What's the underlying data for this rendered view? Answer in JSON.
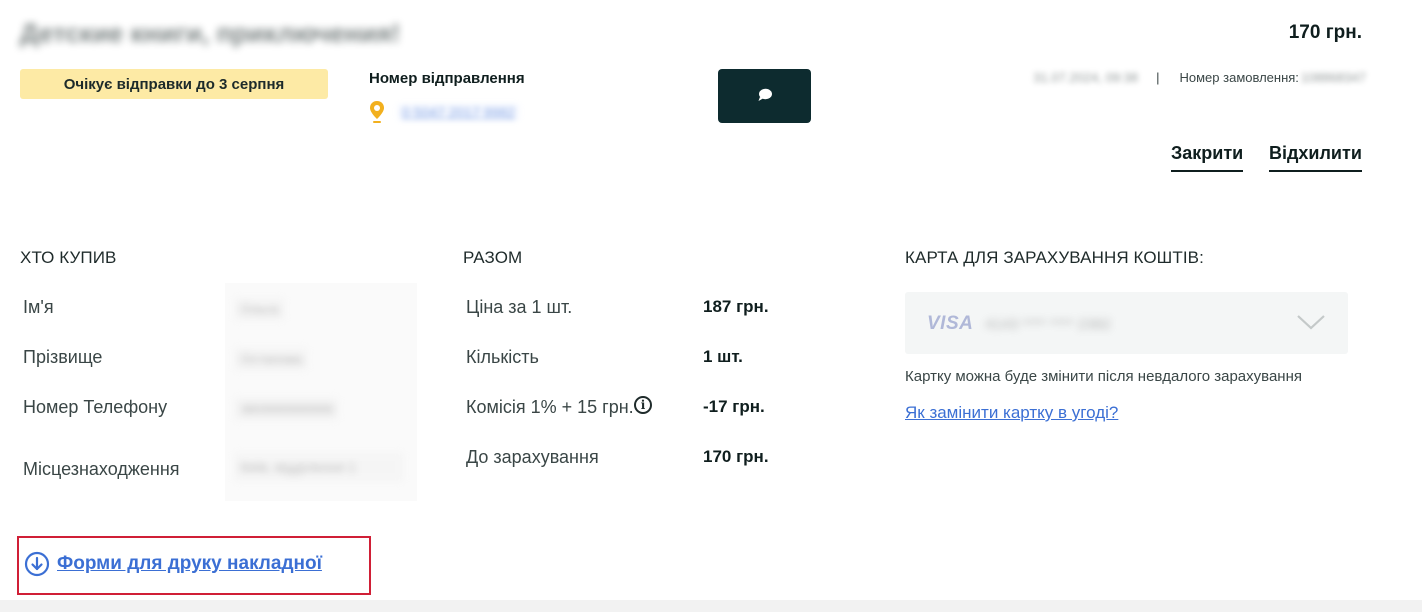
{
  "header": {
    "title": "Детские книги, приключения!",
    "price": "170 грн.",
    "status": "Очікує відправки до 3 серпня",
    "shipment_label": "Номер відправлення",
    "shipment_number": "0 5047 2017 9982",
    "order_date": "31.07.2024, 09:38",
    "order_separator": "|",
    "order_number_label": "Номер замовлення:",
    "order_number": "108868347"
  },
  "actions": {
    "close": "Закрити",
    "decline": "Відхилити"
  },
  "buyer": {
    "heading": "ХТО КУПИВ",
    "rows": [
      {
        "label": "Ім'я",
        "value": "Ольга"
      },
      {
        "label": "Прізвище",
        "value": "Остапова"
      },
      {
        "label": "Номер Телефону",
        "value": "380999999999"
      },
      {
        "label": "Місцезнаходження",
        "value": "Київ, відділення 1"
      }
    ]
  },
  "summary": {
    "heading": "РАЗОМ",
    "rows": [
      {
        "label": "Ціна за 1 шт.",
        "value": "187 грн."
      },
      {
        "label": "Кількість",
        "value": "1 шт."
      },
      {
        "label": "Комісія 1% + 15 грн.",
        "value": "-17 грн."
      },
      {
        "label": "До зарахування",
        "value": "170 грн."
      }
    ]
  },
  "card": {
    "heading": "КАРТА ДЛЯ ЗАРАХУВАННЯ КОШТІВ:",
    "brand": "VISA",
    "masked_number": "4143 **** **** 2382",
    "note": "Картку можна буде змінити після невдалого зарахування",
    "help_link": "Як замінити картку в угоді?"
  },
  "print": {
    "link": "Форми для друку накладної"
  },
  "colors": {
    "accent_dark": "#0d2b2f",
    "badge_yellow": "#fdeaa5",
    "link_blue": "#3b6fd4",
    "highlight_red": "#d01f36",
    "pin_yellow": "#f2b01e"
  },
  "icons": {
    "location": "location-pin-icon",
    "chat": "chat-bubble-icon",
    "info": "info-icon",
    "chevron": "chevron-down-icon",
    "download": "download-circle-icon"
  }
}
